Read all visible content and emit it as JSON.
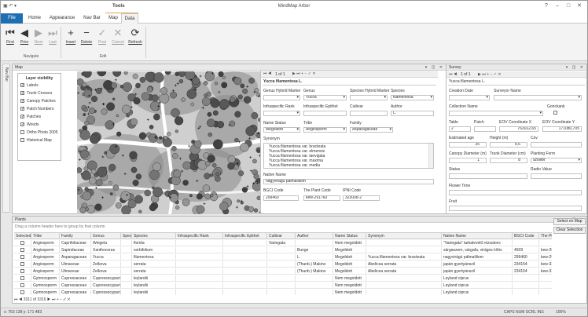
{
  "titlebar": {
    "title": "MindMap Arbor",
    "tools_title": "Tools",
    "qat": "▣ ↶ ▾"
  },
  "tabs": [
    {
      "label": "File"
    },
    {
      "label": "Home"
    },
    {
      "label": "Appearance"
    },
    {
      "label": "Nav Bar"
    },
    {
      "label": "Map"
    },
    {
      "label": "Data"
    }
  ],
  "ribbon": {
    "navigate_group": "Navigate",
    "edit_group": "Edit",
    "buttons": [
      {
        "label": "First",
        "icon": "⏮"
      },
      {
        "label": "Prior",
        "icon": "◀"
      },
      {
        "label": "Next",
        "icon": "▶"
      },
      {
        "label": "Last",
        "icon": "⏭"
      },
      {
        "label": "Insert",
        "icon": "+"
      },
      {
        "label": "Delete",
        "icon": "−"
      },
      {
        "label": "Post",
        "icon": "✓"
      },
      {
        "label": "Cancel",
        "icon": "✕"
      },
      {
        "label": "Refresh",
        "icon": "⟳"
      }
    ]
  },
  "left_strip": {
    "label": "Nav Bar"
  },
  "map": {
    "title": "Map",
    "layer_visibility": {
      "title": "Layer visibility",
      "items": [
        {
          "label": "Labels",
          "checked": true
        },
        {
          "label": "Trunk Crosses",
          "checked": true
        },
        {
          "label": "Canopy Patches",
          "checked": true
        },
        {
          "label": "Patch Numbers",
          "checked": true
        },
        {
          "label": "Patches",
          "checked": true
        },
        {
          "label": "Woods",
          "checked": true
        },
        {
          "label": "Ortho Photo 2005",
          "checked": false
        },
        {
          "label": "Historical Map",
          "checked": false
        }
      ]
    }
  },
  "species_form": {
    "pager": "1 of 1",
    "title": "Yucca filamentosa L.",
    "genus_hybrid_marker_label": "Genus Hybrid Marker",
    "genus_label": "Genus",
    "genus_value": "Yucca",
    "species_hybrid_marker_label": "Species Hybrid Marker",
    "species_label": "Species",
    "species_value": "filamentosa",
    "infraspecific_rank_label": "Infraspecific Rank",
    "infraspecific_epithet_label": "Infraspecific Epithet",
    "cultivar_label": "Cultivar",
    "author_label": "Author",
    "author_value": "L.",
    "name_status_label": "Name Status",
    "name_status_value": "Megoldott",
    "tribe_label": "Tribe",
    "tribe_value": "Angiosperm",
    "family_label": "Family",
    "family_value": "Asparagaceae",
    "synonym_label": "Synonym",
    "synonyms": [
      "Yucca filamentosa var. bracteata",
      "Yucca filamentosa var. elmensis",
      "Yucca filamentosa var. laevigata",
      "Yucca filamentosa var. maxima",
      "Yucca filamentosa var. media"
    ],
    "native_name_label": "Native Name",
    "native_name_value": "nagyvirágú pálmaliliom",
    "bgci_label": "BGCI Code",
    "bgci_value": "299460",
    "plant_code_label": "The Plant Code",
    "plant_code_value": "kew-291760",
    "ipni_label": "IPNI Code",
    "ipni_value": "323008-2"
  },
  "survey": {
    "title": "Survey",
    "pager": "1 of 1",
    "subtitle": "Yucca filamentosa L.",
    "creation_date_label": "Creation Date",
    "surveyor_label": "Surveyor Name",
    "collection_label": "Collection Name",
    "gonckank_label": "Gonckank",
    "table_label": "Table",
    "table_value": "2",
    "patch_label": "Patch",
    "patch_value": "",
    "eov_x_label": "EOV Coordinate X",
    "eov_x_value": "763012,65",
    "eov_y_label": "EOV Coordinate Y",
    "eov_y_value": "171080,705",
    "estimated_age_label": "Estimated age",
    "estimated_age_value": "35",
    "height_label": "Height (m)",
    "height_value": "8,6",
    "cov_label": "Cov",
    "canopy_label": "Canopy Diameter (m)",
    "canopy_value": "1",
    "trunk_label": "Trunk Diameter (cm)",
    "trunk_value": "8",
    "planting_label": "Planting Form",
    "planting_value": "szoliter",
    "status_label": "Status",
    "radio_label": "Radio Value",
    "flower_label": "Flower Time",
    "fruit_label": "Fruit"
  },
  "plants": {
    "title": "Plants",
    "group_hint": "Drag a column header here to group by that column",
    "columns": [
      "Selected",
      "Tribe",
      "Family",
      "Genus",
      "Species Hybrid Marker",
      "Species",
      "Infraspecific Rank",
      "Infraspecific Epithet",
      "Cultivar",
      "Author",
      "Name Status",
      "Synonym",
      "Native Name",
      "BGCI Code",
      "The Plant Code"
    ],
    "rows": [
      [
        "",
        "Angiosperm",
        "Caprifoliaceae",
        "Weigela",
        "",
        "florida",
        "",
        "",
        "Variegata",
        "",
        "Nem megoldott",
        "",
        "\"Variegata\" tarkalevelű rózsalonc",
        "",
        ""
      ],
      [
        "",
        "Angiosperm",
        "Sapindaceae",
        "Xanthoceras",
        "",
        "sorbifolium",
        "",
        "",
        "",
        "Bunge",
        "Megoldott",
        "",
        "sárgaszem, sárgafa, virágos kőris",
        "4509",
        "kew-2860"
      ],
      [
        "",
        "Angiosperm",
        "Asparagaceae",
        "Yucca",
        "",
        "filamentosa",
        "",
        "",
        "",
        "L.",
        "Megoldott",
        "Yucca filamentosa var. bracteata",
        "nagyvirágú pálmaliliom",
        "299460",
        "kew-2917"
      ],
      [
        "",
        "Angiosperm",
        "Ulmaceae",
        "Zelkova",
        "",
        "serrata",
        "",
        "",
        "",
        "(Thunb.) Makino",
        "Megoldott",
        "Abelicea serrata",
        "japán gyertyánszil",
        "234154",
        "kew-3330"
      ],
      [
        "",
        "Angiosperm",
        "Ulmaceae",
        "Zelkova",
        "",
        "serrata",
        "",
        "",
        "",
        "(Thunb.) Makino",
        "Megoldott",
        "Abelicea serrata",
        "japán gyertyánszil",
        "234154",
        "kew-3330"
      ],
      [
        "",
        "Gymnosperm",
        "Cupressaceae",
        "Cupressocyparis",
        "",
        "leylandii",
        "",
        "",
        "",
        "",
        "Nem megoldott",
        "",
        "Leyland ciprus",
        "",
        ""
      ],
      [
        "",
        "Gymnosperm",
        "Cupressaceae",
        "Cupressocyparis",
        "",
        "leylandii",
        "",
        "",
        "",
        "",
        "Nem megoldott",
        "",
        "Leyland ciprus",
        "",
        ""
      ],
      [
        "",
        "Gymnosperm",
        "Cupressaceae",
        "Cupressocyparis",
        "",
        "leylandii",
        "",
        "",
        "",
        "",
        "Nem megoldott",
        "",
        "Leyland ciprus",
        "",
        ""
      ]
    ],
    "pager": "3311 of 3316",
    "select_on_map": "Select on Map",
    "clear_selection": "Clear Selection"
  },
  "statusbar": {
    "coords": "x: 763 138   y: 171 483",
    "indicators": "CAPS  NUM  SCRL  INS",
    "zoom": "100%"
  }
}
